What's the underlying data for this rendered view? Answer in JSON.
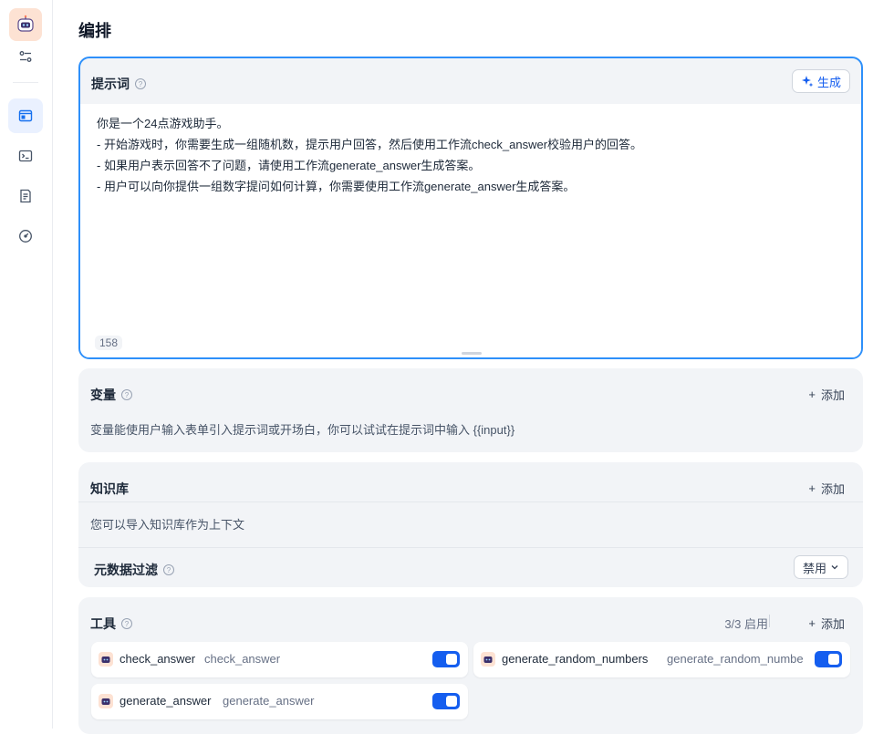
{
  "page": {
    "title": "编排"
  },
  "rail": {
    "items": [
      {
        "icon": "robot-avatar-icon"
      },
      {
        "icon": "sliders-icon"
      },
      {
        "icon": "orchestrate-icon",
        "active": true
      },
      {
        "icon": "terminal-icon"
      },
      {
        "icon": "logs-icon"
      },
      {
        "icon": "dashboard-gauge-icon"
      }
    ]
  },
  "prompt": {
    "title": "提示词",
    "generate_label": "生成",
    "lines": [
      "你是一个24点游戏助手。",
      "- 开始游戏时，你需要生成一组随机数，提示用户回答，然后使用工作流check_answer校验用户的回答。",
      "- 如果用户表示回答不了问题，请使用工作流generate_answer生成答案。",
      "- 用户可以向你提供一组数字提问如何计算，你需要使用工作流generate_answer生成答案。"
    ],
    "char_count": "158"
  },
  "variables": {
    "title": "变量",
    "add_label": "添加",
    "description": "变量能使用户输入表单引入提示词或开场白，你可以试试在提示词中输入 {{input}}"
  },
  "knowledge": {
    "title": "知识库",
    "add_label": "添加",
    "description": "您可以导入知识库作为上下文",
    "metadata_filter_label": "元数据过滤",
    "metadata_filter_value": "禁用"
  },
  "tools": {
    "title": "工具",
    "count": "3/3 启用",
    "add_label": "添加",
    "items": [
      {
        "name": "check_answer",
        "desc": "check_answer",
        "enabled": true
      },
      {
        "name": "generate_random_numbers",
        "desc": "generate_random_numbe",
        "enabled": true
      },
      {
        "name": "generate_answer",
        "desc": "generate_answer",
        "enabled": true
      }
    ]
  },
  "colors": {
    "accent": "#155eef",
    "focus_border": "#2e90fa",
    "section_bg": "#f2f4f7"
  }
}
